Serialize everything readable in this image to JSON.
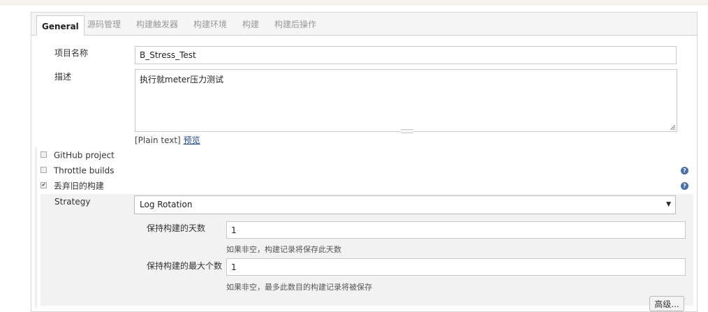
{
  "tabs": [
    {
      "label": "General",
      "active": true
    },
    {
      "label": "源码管理",
      "active": false
    },
    {
      "label": "构建触发器",
      "active": false
    },
    {
      "label": "构建环境",
      "active": false
    },
    {
      "label": "构建",
      "active": false
    },
    {
      "label": "构建后操作",
      "active": false
    }
  ],
  "form": {
    "project_name_label": "项目名称",
    "project_name_value": "B_Stress_Test",
    "description_label": "描述",
    "description_value": "执行就meter压力测试",
    "description_format": "[Plain text]",
    "preview_link": "预览"
  },
  "options": {
    "github_project": {
      "label": "GitHub project",
      "checked": false
    },
    "throttle_builds": {
      "label": "Throttle builds",
      "checked": false
    },
    "discard_old_builds": {
      "label": "丢弃旧的构建",
      "checked": true,
      "checkmark": "✔"
    }
  },
  "strategy": {
    "label": "Strategy",
    "selected": "Log Rotation",
    "arrow": "▼",
    "days_label": "保持构建的天数",
    "days_value": "1",
    "days_hint": "如果非空，构建记录将保存此天数",
    "max_label": "保持构建的最大个数",
    "max_value": "1",
    "max_hint": "如果非空，最多此数目的构建记录将被保存",
    "advanced_button": "高级..."
  },
  "icons": {
    "help": "?",
    "help_color": "#4a6fa8"
  }
}
